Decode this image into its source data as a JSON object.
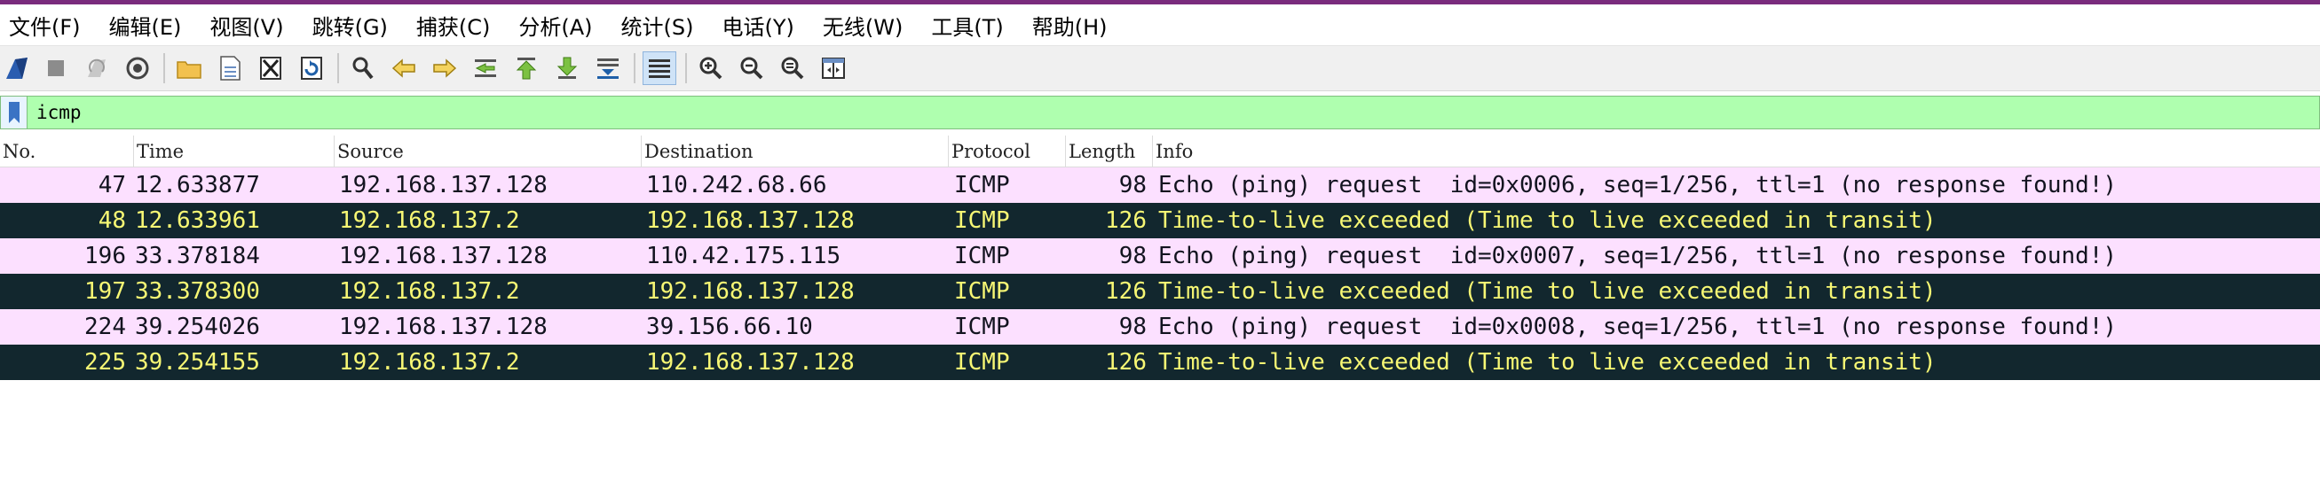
{
  "menu": [
    "文件(F)",
    "编辑(E)",
    "视图(V)",
    "跳转(G)",
    "捕获(C)",
    "分析(A)",
    "统计(S)",
    "电话(Y)",
    "无线(W)",
    "工具(T)",
    "帮助(H)"
  ],
  "toolbar": {
    "icons": [
      "start-capture-icon",
      "stop-capture-icon",
      "restart-capture-icon",
      "capture-options-icon",
      "open-file-icon",
      "save-file-icon",
      "close-file-icon",
      "reload-file-icon",
      "find-packet-icon",
      "go-back-icon",
      "go-forward-icon",
      "go-to-packet-icon",
      "go-first-icon",
      "go-last-icon",
      "autoscroll-icon",
      "colorize-icon",
      "zoom-in-icon",
      "zoom-out-icon",
      "zoom-normal-icon",
      "resize-columns-icon"
    ],
    "active": "colorize-icon"
  },
  "filter": {
    "value": "icmp"
  },
  "columns": [
    "No.",
    "Time",
    "Source",
    "Destination",
    "Protocol",
    "Length",
    "Info"
  ],
  "colors": {
    "filter_valid_bg": "#afffaf",
    "echo_request_bg": "#fce0ff",
    "ttl_exceeded_bg": "#12272e",
    "ttl_exceeded_fg": "#f7f774",
    "accent": "#7a2c7d"
  },
  "packets": [
    {
      "no": "47",
      "time": "12.633877",
      "source": "192.168.137.128",
      "destination": "110.242.68.66",
      "protocol": "ICMP",
      "length": "98",
      "info": "Echo (ping) request  id=0x0006, seq=1/256, ttl=1 (no response found!)",
      "kind": "req"
    },
    {
      "no": "48",
      "time": "12.633961",
      "source": "192.168.137.2",
      "destination": "192.168.137.128",
      "protocol": "ICMP",
      "length": "126",
      "info": "Time-to-live exceeded (Time to live exceeded in transit)",
      "kind": "ttl"
    },
    {
      "no": "196",
      "time": "33.378184",
      "source": "192.168.137.128",
      "destination": "110.42.175.115",
      "protocol": "ICMP",
      "length": "98",
      "info": "Echo (ping) request  id=0x0007, seq=1/256, ttl=1 (no response found!)",
      "kind": "req"
    },
    {
      "no": "197",
      "time": "33.378300",
      "source": "192.168.137.2",
      "destination": "192.168.137.128",
      "protocol": "ICMP",
      "length": "126",
      "info": "Time-to-live exceeded (Time to live exceeded in transit)",
      "kind": "ttl"
    },
    {
      "no": "224",
      "time": "39.254026",
      "source": "192.168.137.128",
      "destination": "39.156.66.10",
      "protocol": "ICMP",
      "length": "98",
      "info": "Echo (ping) request  id=0x0008, seq=1/256, ttl=1 (no response found!)",
      "kind": "req"
    },
    {
      "no": "225",
      "time": "39.254155",
      "source": "192.168.137.2",
      "destination": "192.168.137.128",
      "protocol": "ICMP",
      "length": "126",
      "info": "Time-to-live exceeded (Time to live exceeded in transit)",
      "kind": "ttl"
    }
  ]
}
